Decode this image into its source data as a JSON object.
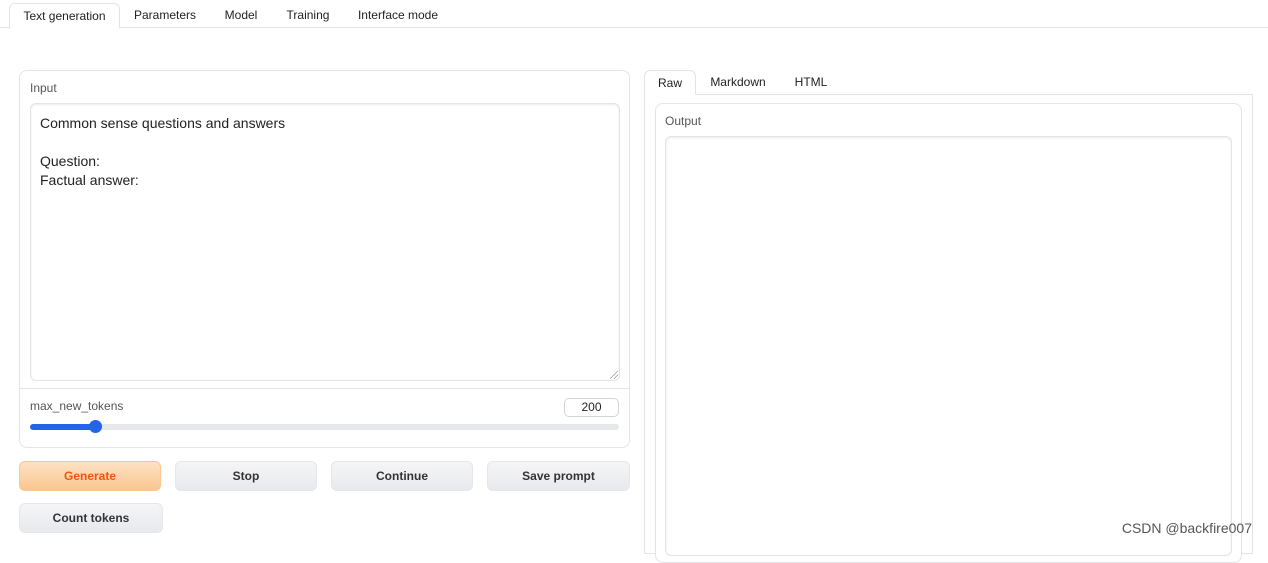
{
  "top_tabs": [
    {
      "label": "Text generation",
      "active": true
    },
    {
      "label": "Parameters",
      "active": false
    },
    {
      "label": "Model",
      "active": false
    },
    {
      "label": "Training",
      "active": false
    },
    {
      "label": "Interface mode",
      "active": false
    }
  ],
  "input": {
    "label": "Input",
    "value": "Common sense questions and answers\n\nQuestion:\nFactual answer:"
  },
  "max_new_tokens": {
    "label": "max_new_tokens",
    "value": "200",
    "fraction": 0.11
  },
  "buttons": {
    "generate": "Generate",
    "stop": "Stop",
    "continue": "Continue",
    "save_prompt": "Save prompt",
    "count_tokens": "Count tokens"
  },
  "output_tabs": [
    {
      "label": "Raw",
      "active": true
    },
    {
      "label": "Markdown",
      "active": false
    },
    {
      "label": "HTML",
      "active": false
    }
  ],
  "output": {
    "label": "Output",
    "value": ""
  },
  "watermark": "CSDN @backfire007",
  "colors": {
    "accent": "#2563eb",
    "primary_button_text": "#ea580c"
  }
}
